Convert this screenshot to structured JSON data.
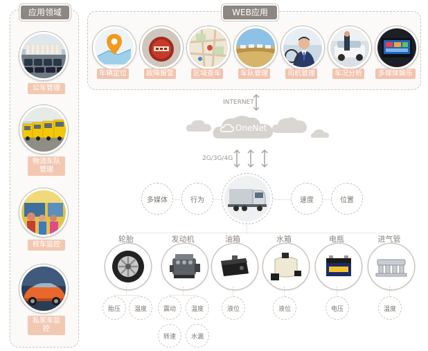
{
  "side": {
    "title": "应用领域",
    "items": [
      {
        "label": "公车管理"
      },
      {
        "label": "物流车队管理"
      },
      {
        "label": "校车监控"
      },
      {
        "label": "私家车监控"
      }
    ]
  },
  "web": {
    "title": "WEB应用",
    "items": [
      {
        "label": "车辆定位"
      },
      {
        "label": "故障报警"
      },
      {
        "label": "区域查车"
      },
      {
        "label": "车队管理"
      },
      {
        "label": "司机管理"
      },
      {
        "label": "车况分析"
      },
      {
        "label": "多媒体娱乐"
      }
    ]
  },
  "network": {
    "internet": "INTERNET",
    "onenet": "OneNet",
    "cellular": "2G/3G/4G"
  },
  "center": {
    "left_nodes": [
      "多媒体",
      "行为"
    ],
    "right_nodes": [
      "速度",
      "位置"
    ]
  },
  "components": [
    {
      "name": "轮胎",
      "subs": [
        "胎压",
        "温度"
      ]
    },
    {
      "name": "发动机",
      "subs": [
        "震动",
        "温度",
        "转速",
        "水漏"
      ]
    },
    {
      "name": "油箱",
      "subs": [
        "液位"
      ]
    },
    {
      "name": "水箱",
      "subs": [
        "液位"
      ]
    },
    {
      "name": "电瓶",
      "subs": [
        "电压"
      ]
    },
    {
      "name": "进气管",
      "subs": [
        "温度"
      ]
    }
  ],
  "colors": {
    "tag": "#8c8782",
    "label_pink": "#f3c2ad",
    "dashed": "#c9c3bd"
  }
}
